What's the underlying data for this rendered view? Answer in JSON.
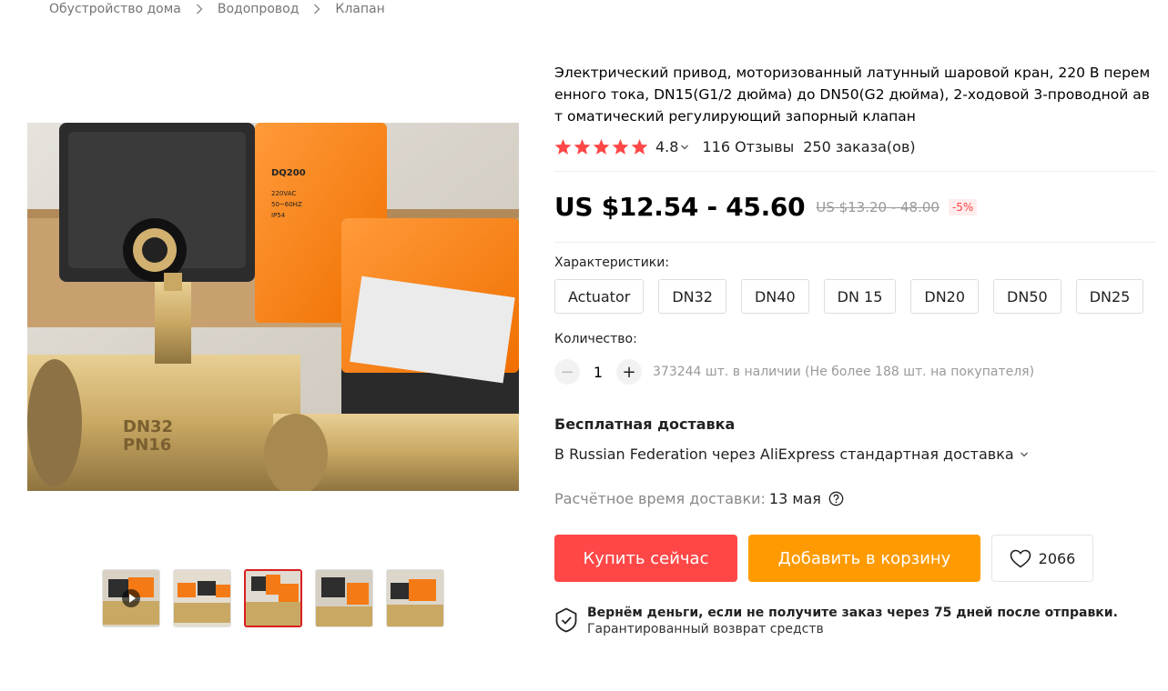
{
  "breadcrumb": [
    "Обустройство дома",
    "Водопровод",
    "Клапан"
  ],
  "product": {
    "title": "Электрический привод, моторизованный латунный шаровой кран, 220 В перем енного тока, DN15(G1/2 дюйма) до DN50(G2 дюйма), 2-ходовой 3-проводной авт оматический регулирующий запорный клапан",
    "rating": 4.8,
    "rating_text": "4.8",
    "reviews": "116 Отзывы",
    "orders": "250 заказа(ов)",
    "price": "US $12.54 - 45.60",
    "old_price": "US $13.20 - 48.00",
    "discount": "-5%"
  },
  "characteristics": {
    "label": "Характеристики:",
    "options": [
      "Actuator",
      "DN32",
      "DN40",
      "DN 15",
      "DN20",
      "DN50",
      "DN25"
    ]
  },
  "quantity": {
    "label": "Количество:",
    "minus": "−",
    "plus": "+",
    "value": "1",
    "stock": "373244 шт. в наличии (Не более 188 шт. на покупателя)"
  },
  "shipping": {
    "title": "Бесплатная доставка",
    "line": "В Russian Federation через AliExpress стандартная доставка",
    "eta_label": "Расчётное время доставки:",
    "eta_date": "13 мая"
  },
  "actions": {
    "buy": "Купить сейчас",
    "cart": "Добавить в корзину",
    "wish_count": "2066"
  },
  "guarantee": {
    "title": "Вернём деньги, если не получите заказ через 75 дней после отправки.",
    "subtitle": "Гарантированный возврат средств"
  },
  "gallery": {
    "thumb_count": 5,
    "active_thumb": 3
  },
  "colors": {
    "buy": "#ff4747",
    "cart": "#ff9b00",
    "star": "#ff4747",
    "accent_red": "#d91f1f"
  }
}
